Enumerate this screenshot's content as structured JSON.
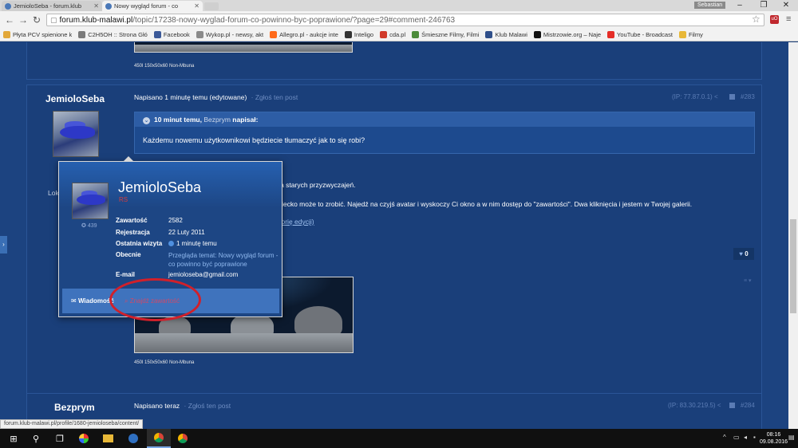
{
  "browser": {
    "tabs": [
      {
        "title": "JemioloSeba - forum.klub",
        "active": false
      },
      {
        "title": "Nowy wygląd forum - co",
        "active": true
      }
    ],
    "profile_name": "Sebastian",
    "url_domain": "forum.klub-malawi.pl",
    "url_path": "/topic/17238-nowy-wyglad-forum-co-powinno-byc-poprawione/?page=29#comment-246763",
    "bookmarks": [
      {
        "label": "Płyta PCV spienione k",
        "color": "#e2a83a"
      },
      {
        "label": "C2H5OH :: Strona Głó",
        "color": "#7a7a7a"
      },
      {
        "label": "Facebook",
        "color": "#3b5998"
      },
      {
        "label": "Wykop.pl - newsy, akt",
        "color": "#8a8a8a"
      },
      {
        "label": "Allegro.pl - aukcje inte",
        "color": "#ff6a1a"
      },
      {
        "label": "Inteligo",
        "color": "#333333"
      },
      {
        "label": "cda.pl",
        "color": "#d13a2a"
      },
      {
        "label": "Śmieszne Filmy, Filmi",
        "color": "#4c8b3a"
      },
      {
        "label": "Klub Malawi",
        "color": "#2f4f8a"
      },
      {
        "label": "Mistrzowie.org – Naje",
        "color": "#111111"
      },
      {
        "label": "YouTube - Broadcast",
        "color": "#e52d27"
      }
    ],
    "bookmark_folder": "Filmy",
    "status_url": "forum.klub-malawi.pl/profile/1680-jemioloseba/content/"
  },
  "prev_post": {
    "caption": "450l 150x50x60 Non-Mbuna"
  },
  "post": {
    "author": "JemioloSeba",
    "meta": "Napisano 1 minutę temu (edytowane)",
    "report": "Zgłoś ten post",
    "ip": "(IP: 77.87.0.1)",
    "number": "#283",
    "quote": {
      "when": "10 minut temu,",
      "user": "Bezprym",
      "said": "napisał:",
      "text": "Każdemu nowemu użytkownikowi będziecie tłumaczyć jak to się robi?"
    },
    "side_label": "Lok",
    "body_line1": "ma starych przyzwyczajeń.",
    "body_line2": "dziecko może to zrobić. Najedź na czyjś avatar i wyskoczy Ci okno a w nim dostęp do \"zawartości\". Dwa kliknięcia i jestem w Twojej galerii.",
    "history_link": "istorię edycji)",
    "likes": "0",
    "caption": "450l 150x50x60 Non-Mbuna"
  },
  "hovercard": {
    "name": "JemioloSeba",
    "group": "RS",
    "reputation": "439",
    "rows": [
      {
        "key": "Zawartość",
        "value": "2582"
      },
      {
        "key": "Rejestracja",
        "value": "22 Luty 2011"
      },
      {
        "key": "Ostatnia wizyta",
        "value": "1 minutę temu"
      },
      {
        "key": "Obecnie",
        "value": "Przegląda temat: Nowy wygląd forum - co powinno być poprawione"
      },
      {
        "key": "E-mail",
        "value": "jemioloseba@gmail.com"
      }
    ],
    "message_button": "Wiadomość",
    "find_content": "Znajdź zawartość"
  },
  "next_post": {
    "author": "Bezprym",
    "meta": "Napisano teraz",
    "report": "Zgłoś ten post",
    "ip": "(IP: 83.30.219.5)",
    "number": "#284"
  },
  "taskbar": {
    "time": "08:16",
    "date": "09.08.2016"
  },
  "colors": {
    "page_bg": "#1c4380",
    "post_bg": "#1a3f7a",
    "accent_link": "#9ec0ee",
    "annotation_red": "#d1202a"
  }
}
